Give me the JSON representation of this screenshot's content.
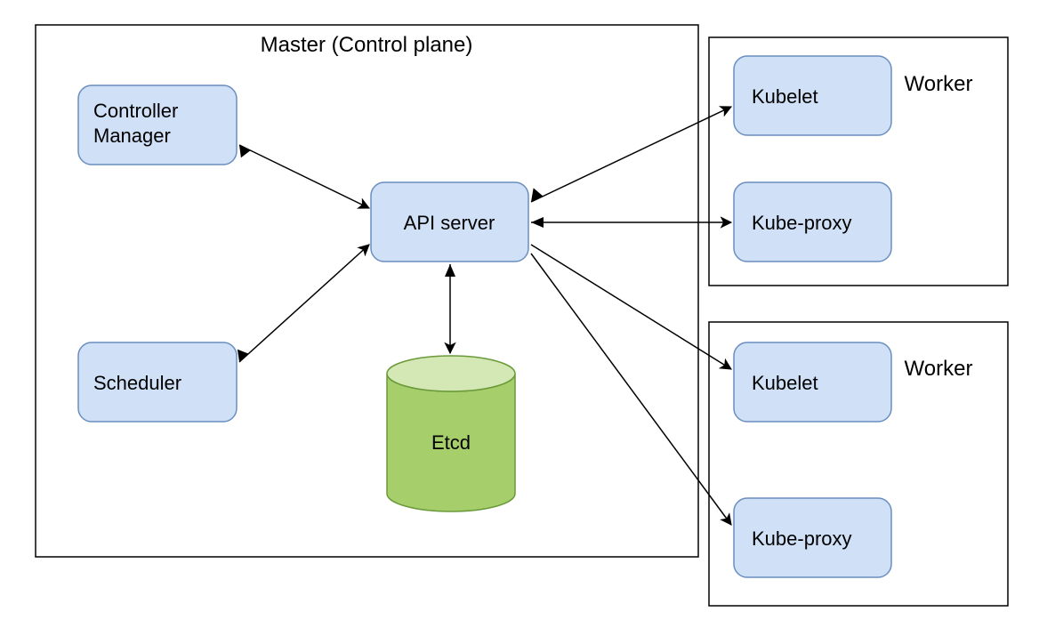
{
  "master": {
    "title": "Master (Control plane)",
    "controller_manager": "Controller\nManager",
    "scheduler": "Scheduler",
    "api_server": "API server",
    "etcd": "Etcd"
  },
  "workers": [
    {
      "title": "Worker",
      "kubelet": "Kubelet",
      "kube_proxy": "Kube-proxy"
    },
    {
      "title": "Worker",
      "kubelet": "Kubelet",
      "kube_proxy": "Kube-proxy"
    }
  ]
}
